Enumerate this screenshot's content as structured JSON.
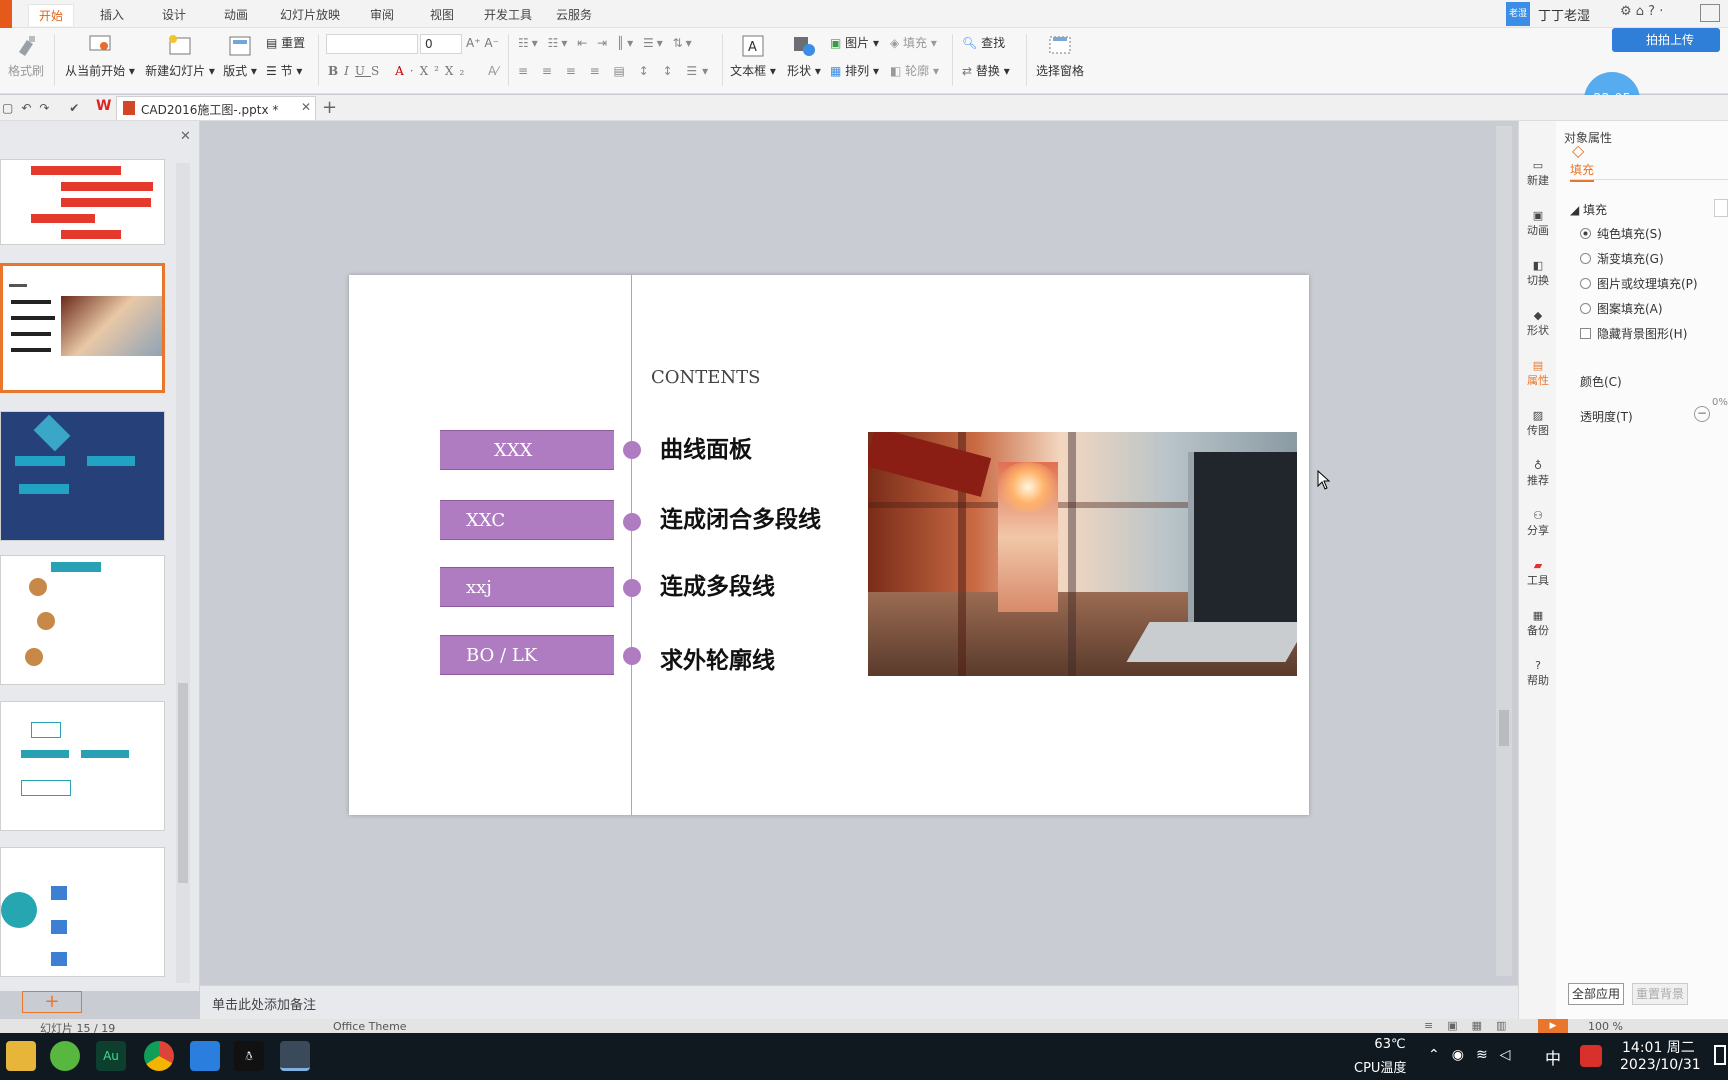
{
  "menu": {
    "tabs": [
      "开始",
      "插入",
      "设计",
      "动画",
      "幻灯片放映",
      "审阅",
      "视图",
      "开发工具",
      "云服务"
    ],
    "user": "丁丁老湿",
    "upload_label": "拍拍上传",
    "clock_badge": "22:05"
  },
  "ribbon": {
    "format_painter": "格式刷",
    "from_current": "从当前开始",
    "new_slide": "新建幻灯片",
    "layout": "版式",
    "reset": "重置",
    "section": "节",
    "font_size": "0",
    "textbox": "文本框",
    "shape": "形状",
    "picture": "图片",
    "fill": "填充",
    "arrange": "排列",
    "outline": "轮廓",
    "find": "查找",
    "replace": "替换",
    "select_pane": "选择窗格"
  },
  "doc_tab": {
    "title": "CAD2016施工图-.pptx *"
  },
  "slide": {
    "contents_label": "CONTENTS",
    "items": [
      {
        "tag": "XXX",
        "text": "曲线面板"
      },
      {
        "tag": "XXC",
        "text": "连成闭合多段线"
      },
      {
        "tag": "xxj",
        "text": "连成多段线"
      },
      {
        "tag": "BO / LK",
        "text": "求外轮廓线"
      }
    ]
  },
  "notes_placeholder": "单击此处添加备注",
  "status": {
    "slide_index": "幻灯片 15 / 19",
    "theme": "Office Theme",
    "zoom": "100 %"
  },
  "side_tools": [
    "新建",
    "动画",
    "切换",
    "形状",
    "属性",
    "传图",
    "推荐",
    "分享",
    "工具",
    "备份",
    "帮助"
  ],
  "properties": {
    "panel_title": "对象属性",
    "tab_fill": "填充",
    "section_fill": "填充",
    "options": [
      "纯色填充(S)",
      "渐变填充(G)",
      "图片或纹理填充(P)",
      "图案填充(A)"
    ],
    "hide_bg": "隐藏背景图形(H)",
    "color_label": "颜色(C)",
    "transparency_label": "透明度(T)",
    "transparency_value": "0%",
    "apply_all": "全部应用",
    "reset_bg": "重置背景"
  },
  "taskbar": {
    "temperature": "63℃",
    "temp_label": "CPU温度",
    "ime": "中",
    "time": "14:01 周二",
    "date": "2023/10/31"
  }
}
